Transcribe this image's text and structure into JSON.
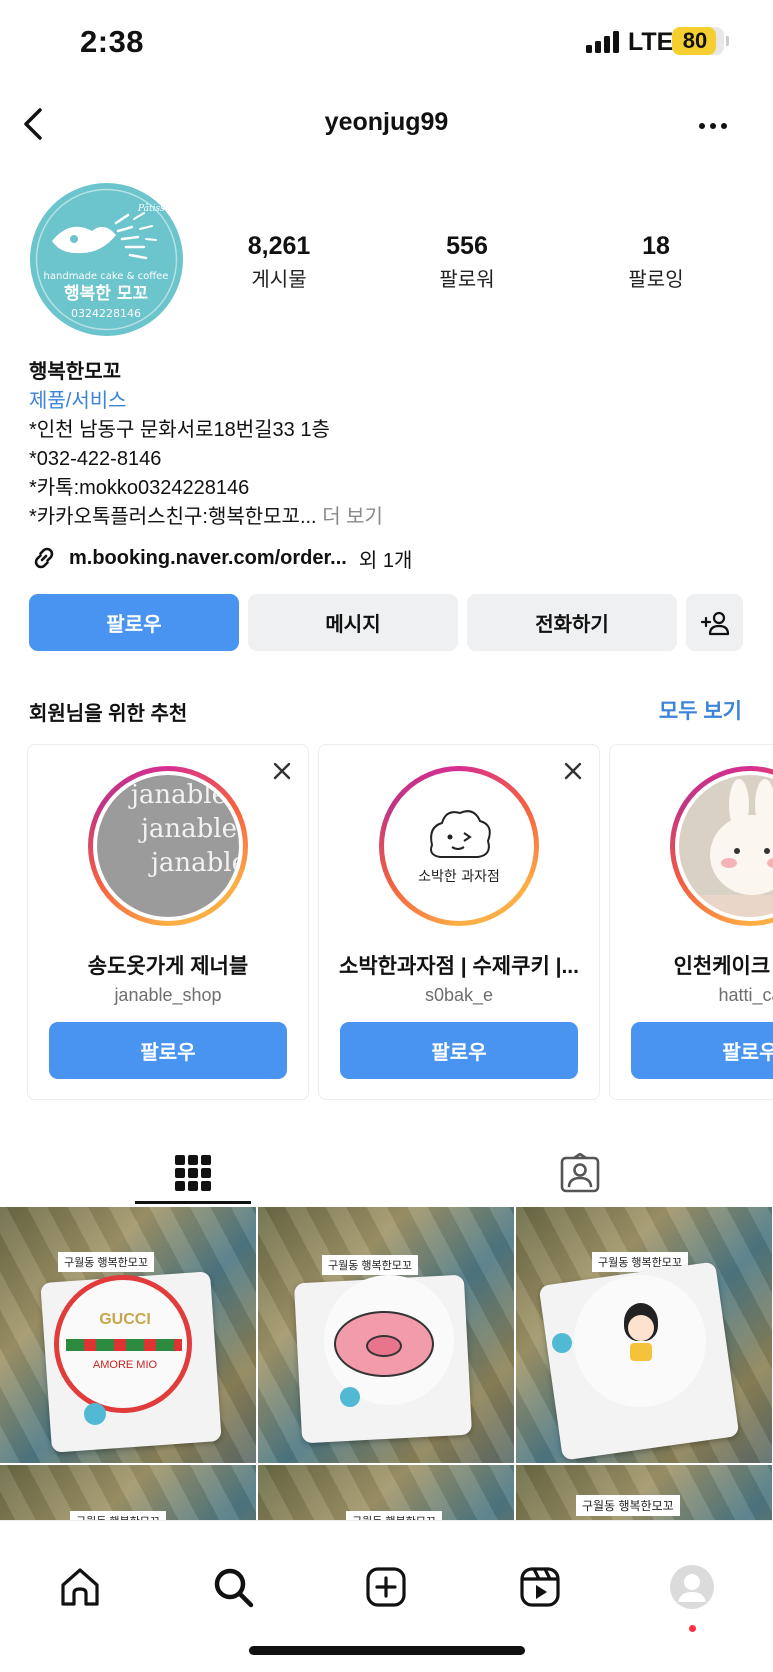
{
  "status_bar": {
    "time": "2:38",
    "network": "LTE",
    "battery": "80"
  },
  "header": {
    "username": "yeonjug99"
  },
  "profile": {
    "avatar_text": "행복한 모꼬",
    "avatar_phone": "0324228146",
    "avatar_tagline": "handmade cake & coffee",
    "avatar_brand": "Pâtisserie",
    "stats": [
      {
        "value": "8,261",
        "label": "게시물"
      },
      {
        "value": "556",
        "label": "팔로워"
      },
      {
        "value": "18",
        "label": "팔로잉"
      }
    ],
    "name": "행복한모꼬",
    "category": "제품/서비스",
    "bio_lines": [
      "*인천 남동구 문화서로18번길33 1층",
      "*032-422-8146",
      "*카톡:mokko0324228146",
      "*카카오톡플러스친구:행복한모꼬..."
    ],
    "more_label": "더 보기",
    "link": "m.booking.naver.com/order...",
    "link_extra": "외 1개"
  },
  "actions": {
    "follow": "팔로우",
    "message": "메시지",
    "call": "전화하기",
    "add_user": "+"
  },
  "suggestions": {
    "title": "회원님을 위한 추천",
    "see_all": "모두 보기",
    "items": [
      {
        "name": "송도옷가게 제너블",
        "handle": "janable_shop",
        "button": "팔로우",
        "pic_text": "janable"
      },
      {
        "name": "소박한과자점 | 수제쿠키 |...",
        "handle": "s0bak_e",
        "button": "팔로우",
        "pic_text": "소박한 과자점"
      },
      {
        "name": "인천케이크 | 청라",
        "handle": "hatti_ca",
        "button": "팔로우",
        "pic_text": ""
      }
    ]
  },
  "posts": [
    {
      "tag": "구월동 행복한모꼬",
      "cake_text": "GUCCI",
      "cake_sub": "AMORE MIO"
    },
    {
      "tag": "구월동 행복한모꼬",
      "cake_text": "",
      "cake_sub": ""
    },
    {
      "tag": "구월동 행복한모꼬",
      "cake_text": "",
      "cake_sub": ""
    },
    {
      "tag": "구월동 행복한모꼬"
    },
    {
      "tag": "구월동 행복한모꼬"
    },
    {
      "tag": "구월동 행복한모꼬"
    }
  ],
  "colors": {
    "accent": "#4894f0",
    "link": "#3b84d9",
    "avatar_bg": "#6cc4cc"
  },
  "nav": [
    "home-icon",
    "search-icon",
    "create-icon",
    "reels-icon",
    "profile-icon"
  ]
}
